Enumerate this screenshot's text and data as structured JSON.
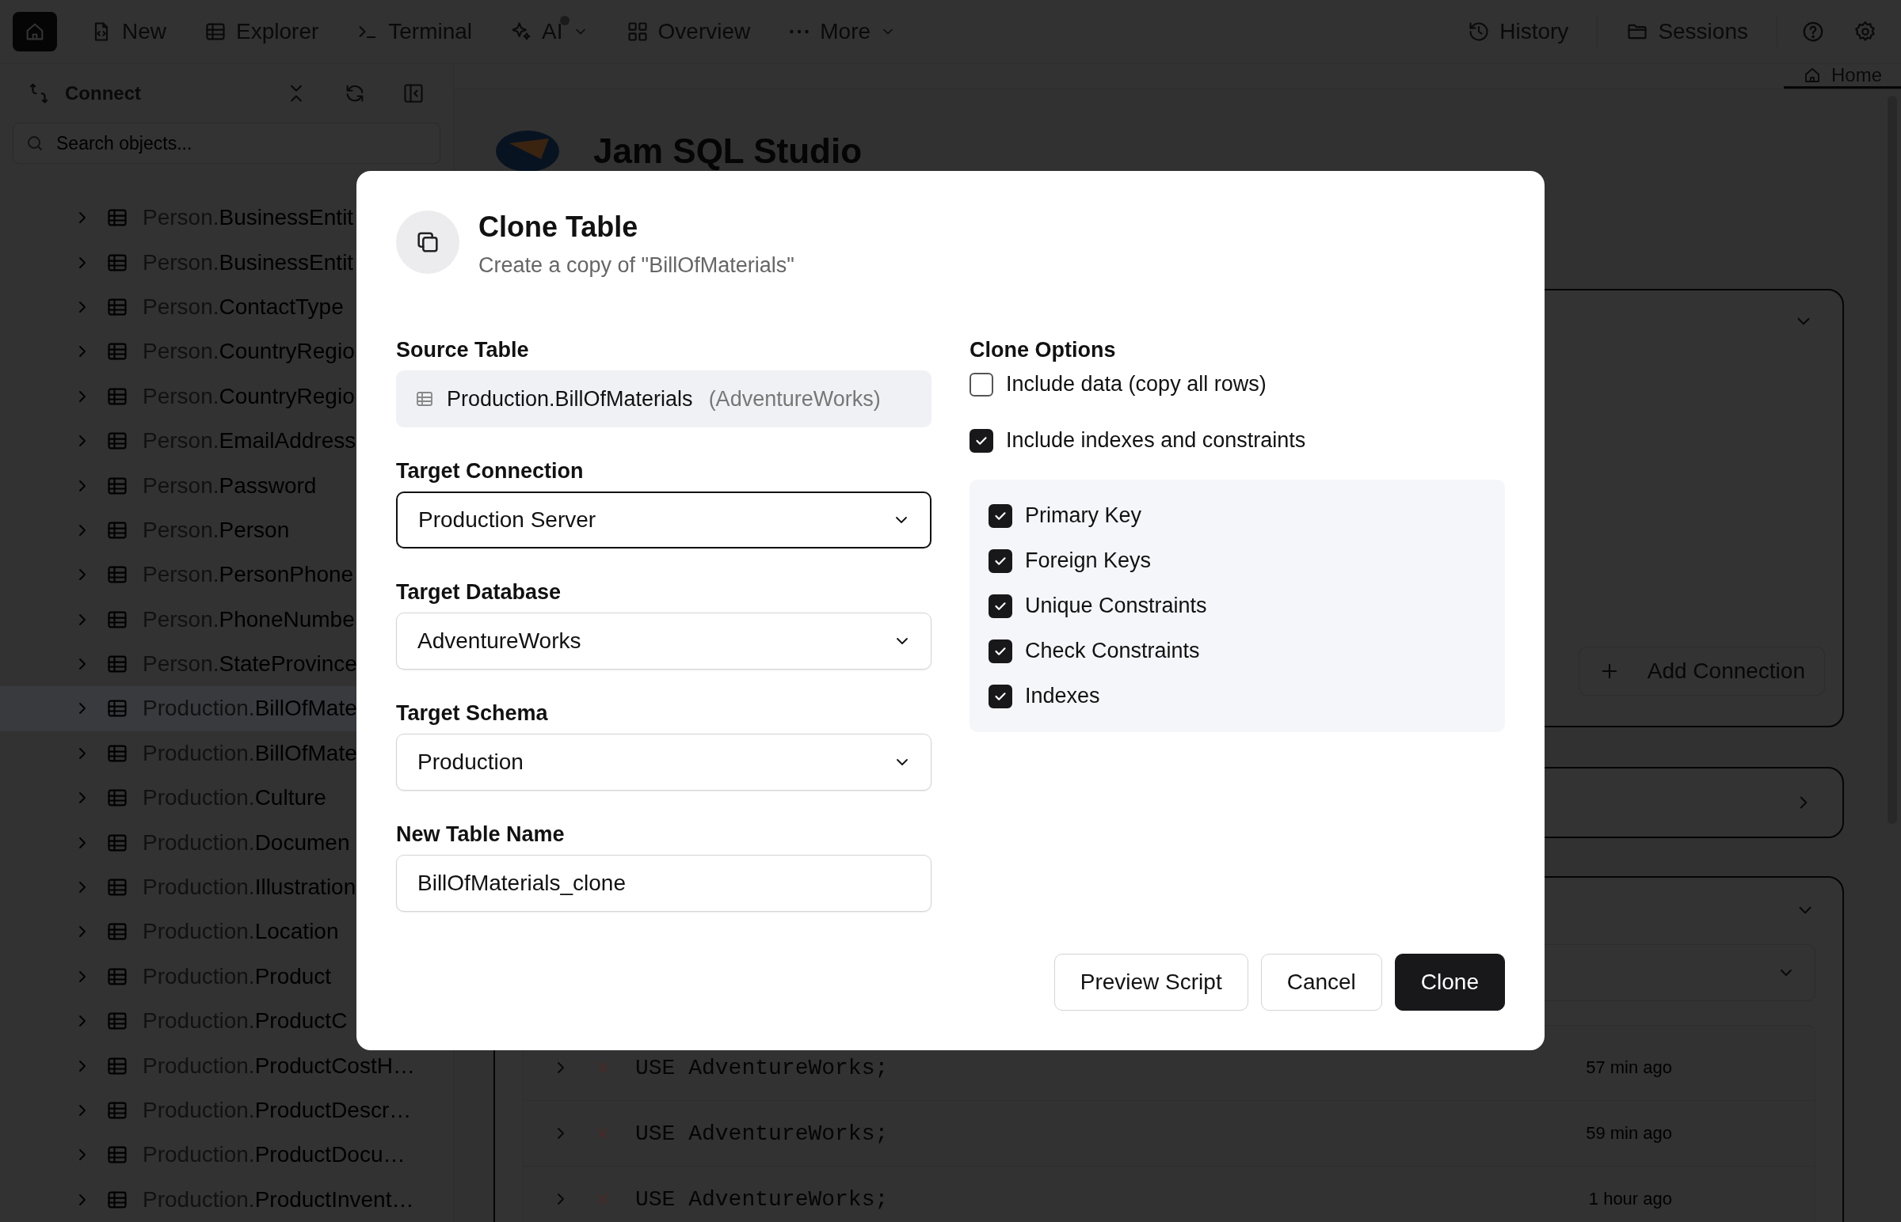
{
  "toolbar": {
    "left": [
      {
        "label": "New",
        "has_dot": false,
        "has_caret": false
      },
      {
        "label": "Explorer",
        "has_dot": false,
        "has_caret": false
      },
      {
        "label": "Terminal",
        "has_dot": false,
        "has_caret": false
      },
      {
        "label": "AI",
        "has_dot": true,
        "has_caret": true
      },
      {
        "label": "Overview",
        "has_dot": false,
        "has_caret": false
      },
      {
        "label": "More",
        "has_dot": false,
        "has_caret": true
      }
    ],
    "right": [
      {
        "label": "History"
      },
      {
        "label": "Sessions"
      }
    ]
  },
  "sidebar": {
    "title": "Connect",
    "search": {
      "placeholder": "Search objects..."
    },
    "items": [
      {
        "schema": "Person.",
        "name": "BusinessEntit",
        "selected": false
      },
      {
        "schema": "Person.",
        "name": "BusinessEntit",
        "selected": false
      },
      {
        "schema": "Person.",
        "name": "ContactType",
        "selected": false
      },
      {
        "schema": "Person.",
        "name": "CountryRegio",
        "selected": false
      },
      {
        "schema": "Person.",
        "name": "CountryRegio",
        "selected": false
      },
      {
        "schema": "Person.",
        "name": "EmailAddress",
        "selected": false
      },
      {
        "schema": "Person.",
        "name": "Password",
        "selected": false
      },
      {
        "schema": "Person.",
        "name": "Person",
        "selected": false
      },
      {
        "schema": "Person.",
        "name": "PersonPhone",
        "selected": false
      },
      {
        "schema": "Person.",
        "name": "PhoneNumbe",
        "selected": false
      },
      {
        "schema": "Person.",
        "name": "StateProvince",
        "selected": false
      },
      {
        "schema": "Production.",
        "name": "BillOfMate",
        "selected": true
      },
      {
        "schema": "Production.",
        "name": "BillOfMate",
        "selected": false
      },
      {
        "schema": "Production.",
        "name": "Culture",
        "selected": false
      },
      {
        "schema": "Production.",
        "name": "Documen",
        "selected": false
      },
      {
        "schema": "Production.",
        "name": "Illustration",
        "selected": false
      },
      {
        "schema": "Production.",
        "name": "Location",
        "selected": false
      },
      {
        "schema": "Production.",
        "name": "Product",
        "selected": false
      },
      {
        "schema": "Production.",
        "name": "ProductC",
        "selected": false
      },
      {
        "schema": "Production.",
        "name": "ProductCostH…",
        "selected": false
      },
      {
        "schema": "Production.",
        "name": "ProductDescr…",
        "selected": false
      },
      {
        "schema": "Production.",
        "name": "ProductDocu…",
        "selected": false
      },
      {
        "schema": "Production.",
        "name": "ProductInvent…",
        "selected": false
      }
    ]
  },
  "tabs": [
    {
      "label": "Home",
      "selected": true
    }
  ],
  "home": {
    "title": "Jam SQL Studio",
    "add_connection": "Add Connection",
    "history": [
      {
        "query": "USE AdventureWorks;",
        "time": "57 min ago"
      },
      {
        "query": "USE AdventureWorks;",
        "time": "59 min ago"
      },
      {
        "query": "USE AdventureWorks;",
        "time": "1 hour ago"
      }
    ]
  },
  "dialog": {
    "title": "Clone Table",
    "subtitle": "Create a copy of \"BillOfMaterials\"",
    "source": {
      "label": "Source Table",
      "table": "Production.BillOfMaterials",
      "database": "(AdventureWorks)"
    },
    "fields": [
      {
        "label": "Target Connection",
        "value": "Production Server",
        "kind": "select",
        "focused": true
      },
      {
        "label": "Target Database",
        "value": "AdventureWorks",
        "kind": "select",
        "focused": false
      },
      {
        "label": "Target Schema",
        "value": "Production",
        "kind": "select",
        "focused": false
      },
      {
        "label": "New Table Name",
        "value": "BillOfMaterials_clone",
        "kind": "text",
        "focused": false
      }
    ],
    "options_label": "Clone Options",
    "options": [
      {
        "label": "Include data (copy all rows)",
        "checked": false
      },
      {
        "label": "Include indexes and constraints",
        "checked": true
      }
    ],
    "sub_options": [
      {
        "label": "Primary Key",
        "checked": true
      },
      {
        "label": "Foreign Keys",
        "checked": true
      },
      {
        "label": "Unique Constraints",
        "checked": true
      },
      {
        "label": "Check Constraints",
        "checked": true
      },
      {
        "label": "Indexes",
        "checked": true
      }
    ],
    "buttons": [
      {
        "label": "Preview Script",
        "kind": "secondary"
      },
      {
        "label": "Cancel",
        "kind": "secondary"
      },
      {
        "label": "Clone",
        "kind": "primary"
      }
    ]
  }
}
